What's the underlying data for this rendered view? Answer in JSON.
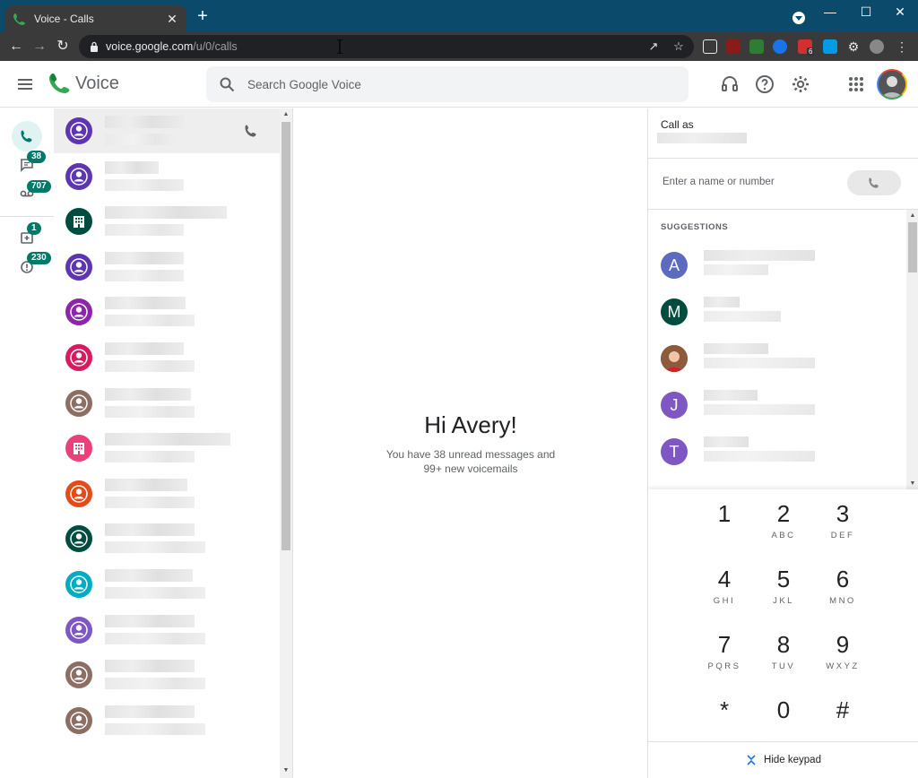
{
  "browser": {
    "tab_title": "Voice - Calls",
    "tab_close": "✕",
    "new_tab": "+",
    "url_host": "voice.google.com",
    "url_path": "/u/0/calls",
    "ext_badge": "6"
  },
  "header": {
    "app_name": "Voice",
    "search_placeholder": "Search Google Voice"
  },
  "rail": {
    "messages_badge": "38",
    "voicemail_badge": "707",
    "archive_badge": "1",
    "spam_badge": "230"
  },
  "calls": {
    "avatar_colors": [
      "#5e35b1",
      "#5e35b1",
      "#004d40",
      "#5e35b1",
      "#8e24aa",
      "#d81b60",
      "#8d6e63",
      "#ec407a",
      "#e64a19",
      "#004d40",
      "#00acc1",
      "#7e57c2",
      "#8d6e63",
      "#8d6e63"
    ],
    "avatar_types": [
      "person",
      "person",
      "building",
      "person",
      "person",
      "person",
      "person",
      "building",
      "person",
      "person",
      "person",
      "person",
      "person",
      "person"
    ]
  },
  "center": {
    "greeting": "Hi Avery!",
    "summary_line1": "You have 38 unread messages and",
    "summary_line2": "99+ new voicemails"
  },
  "dialer": {
    "call_as_label": "Call as",
    "input_placeholder": "Enter a name or number",
    "suggestions_title": "SUGGESTIONS",
    "suggestions": [
      {
        "initial": "A",
        "color": "#5c6bc0"
      },
      {
        "initial": "M",
        "color": "#004d40"
      },
      {
        "initial": "",
        "color": "#a1887f"
      },
      {
        "initial": "J",
        "color": "#7e57c2"
      },
      {
        "initial": "T",
        "color": "#7e57c2"
      }
    ],
    "keys": [
      {
        "digit": "1",
        "letters": ""
      },
      {
        "digit": "2",
        "letters": "ABC"
      },
      {
        "digit": "3",
        "letters": "DEF"
      },
      {
        "digit": "4",
        "letters": "GHI"
      },
      {
        "digit": "5",
        "letters": "JKL"
      },
      {
        "digit": "6",
        "letters": "MNO"
      },
      {
        "digit": "7",
        "letters": "PQRS"
      },
      {
        "digit": "8",
        "letters": "TUV"
      },
      {
        "digit": "9",
        "letters": "WXYZ"
      },
      {
        "digit": "*",
        "letters": ""
      },
      {
        "digit": "0",
        "letters": ""
      },
      {
        "digit": "#",
        "letters": ""
      }
    ],
    "hide_keypad_label": "Hide keypad"
  },
  "colors": {
    "accent": "#00796b",
    "browser_frame": "#0b4a6a"
  }
}
